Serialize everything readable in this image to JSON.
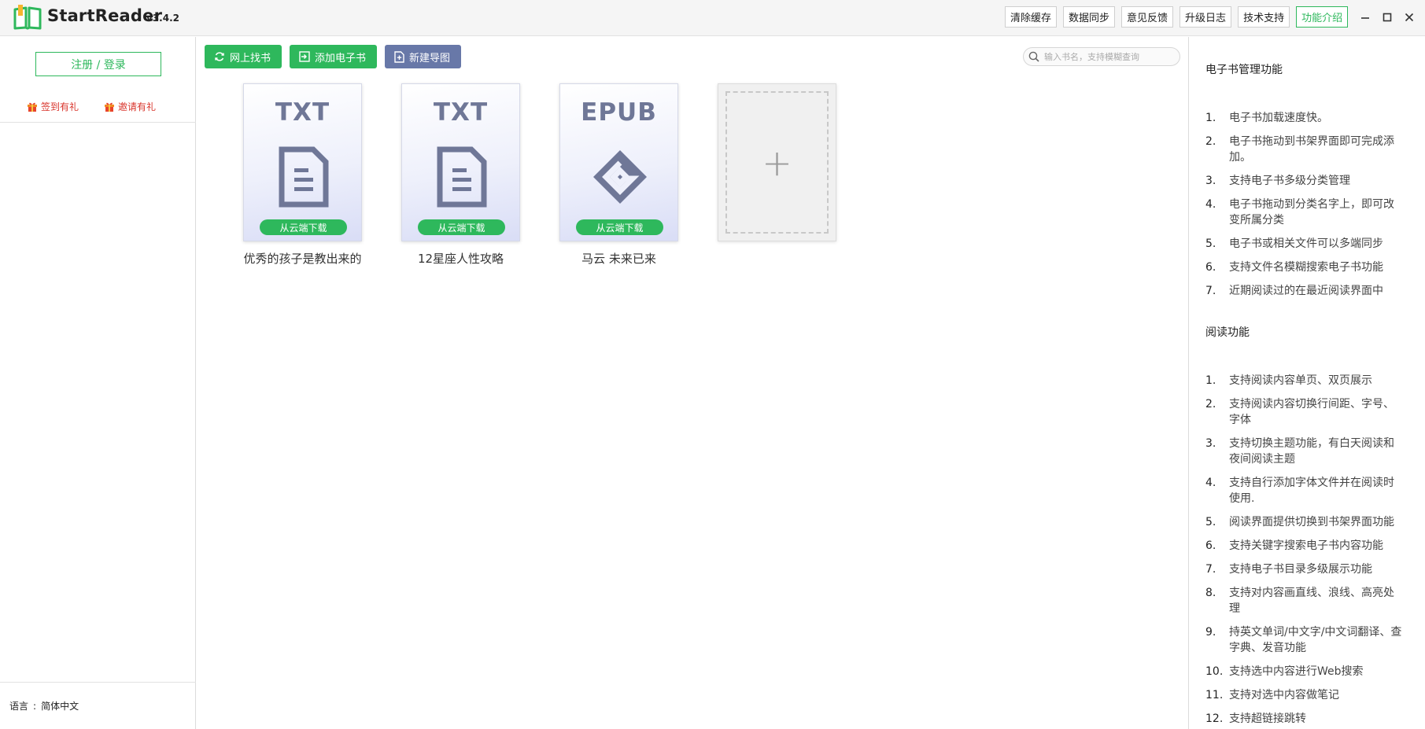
{
  "app": {
    "name": "StartReader",
    "version": "v3.4.2"
  },
  "titlebar": {
    "buttons": [
      "清除缓存",
      "数据同步",
      "意见反馈",
      "升级日志",
      "技术支持",
      "功能介绍"
    ],
    "active_index": 5,
    "minimize": "–",
    "maximize": "□",
    "close": "✕"
  },
  "sidebar": {
    "login": "注册 / 登录",
    "checkin": "签到有礼",
    "invite": "邀请有礼",
    "lang_label": "语言",
    "lang_sep": ":",
    "lang_value": "简体中文"
  },
  "toolbar": {
    "find_online": "网上找书",
    "add_ebook": "添加电子书",
    "new_mindmap": "新建导图"
  },
  "search": {
    "placeholder": "输入书名，支持模糊查询"
  },
  "books": [
    {
      "format": "TXT",
      "title": "优秀的孩子是教出来的",
      "download": "从云端下载"
    },
    {
      "format": "TXT",
      "title": "12星座人性攻略",
      "download": "从云端下载"
    },
    {
      "format": "EPUB",
      "title": "马云 未来已来",
      "download": "从云端下载"
    }
  ],
  "add_card": {
    "symbol": "+"
  },
  "right_panel": {
    "sections": [
      {
        "title": "电子书管理功能",
        "items": [
          {
            "num": "1.",
            "text": "电子书加载速度快。"
          },
          {
            "num": "2.",
            "text": "电子书拖动到书架界面即可完成添加。"
          },
          {
            "num": "3.",
            "text": "支持电子书多级分类管理"
          },
          {
            "num": "4.",
            "text": "电子书拖动到分类名字上，即可改变所属分类"
          },
          {
            "num": "5.",
            "text": "电子书或相关文件可以多端同步"
          },
          {
            "num": "6.",
            "text": "支持文件名模糊搜索电子书功能"
          },
          {
            "num": "7.",
            "text": "近期阅读过的在最近阅读界面中"
          }
        ]
      },
      {
        "title": "阅读功能",
        "items": [
          {
            "num": "1.",
            "text": "支持阅读内容单页、双页展示"
          },
          {
            "num": "2.",
            "text": "支持阅读内容切换行间距、字号、字体"
          },
          {
            "num": "3.",
            "text": "支持切换主题功能，有白天阅读和夜间阅读主题"
          },
          {
            "num": "4.",
            "text": "支持自行添加字体文件并在阅读时使用."
          },
          {
            "num": "5.",
            "text": "阅读界面提供切换到书架界面功能"
          },
          {
            "num": "6.",
            "text": "支持关键字搜索电子书内容功能"
          },
          {
            "num": "7.",
            "text": "支持电子书目录多级展示功能"
          },
          {
            "num": "8.",
            "text": "支持对内容画直线、浪线、高亮处理"
          },
          {
            "num": "9.",
            "text": "持英文单词/中文字/中文词翻译、查字典、发音功能"
          },
          {
            "num": "10.",
            "text": "支持选中内容进行Web搜索"
          },
          {
            "num": "11.",
            "text": "支持对选中内容做笔记"
          },
          {
            "num": "12.",
            "text": "支持超链接跳转"
          }
        ]
      }
    ]
  }
}
